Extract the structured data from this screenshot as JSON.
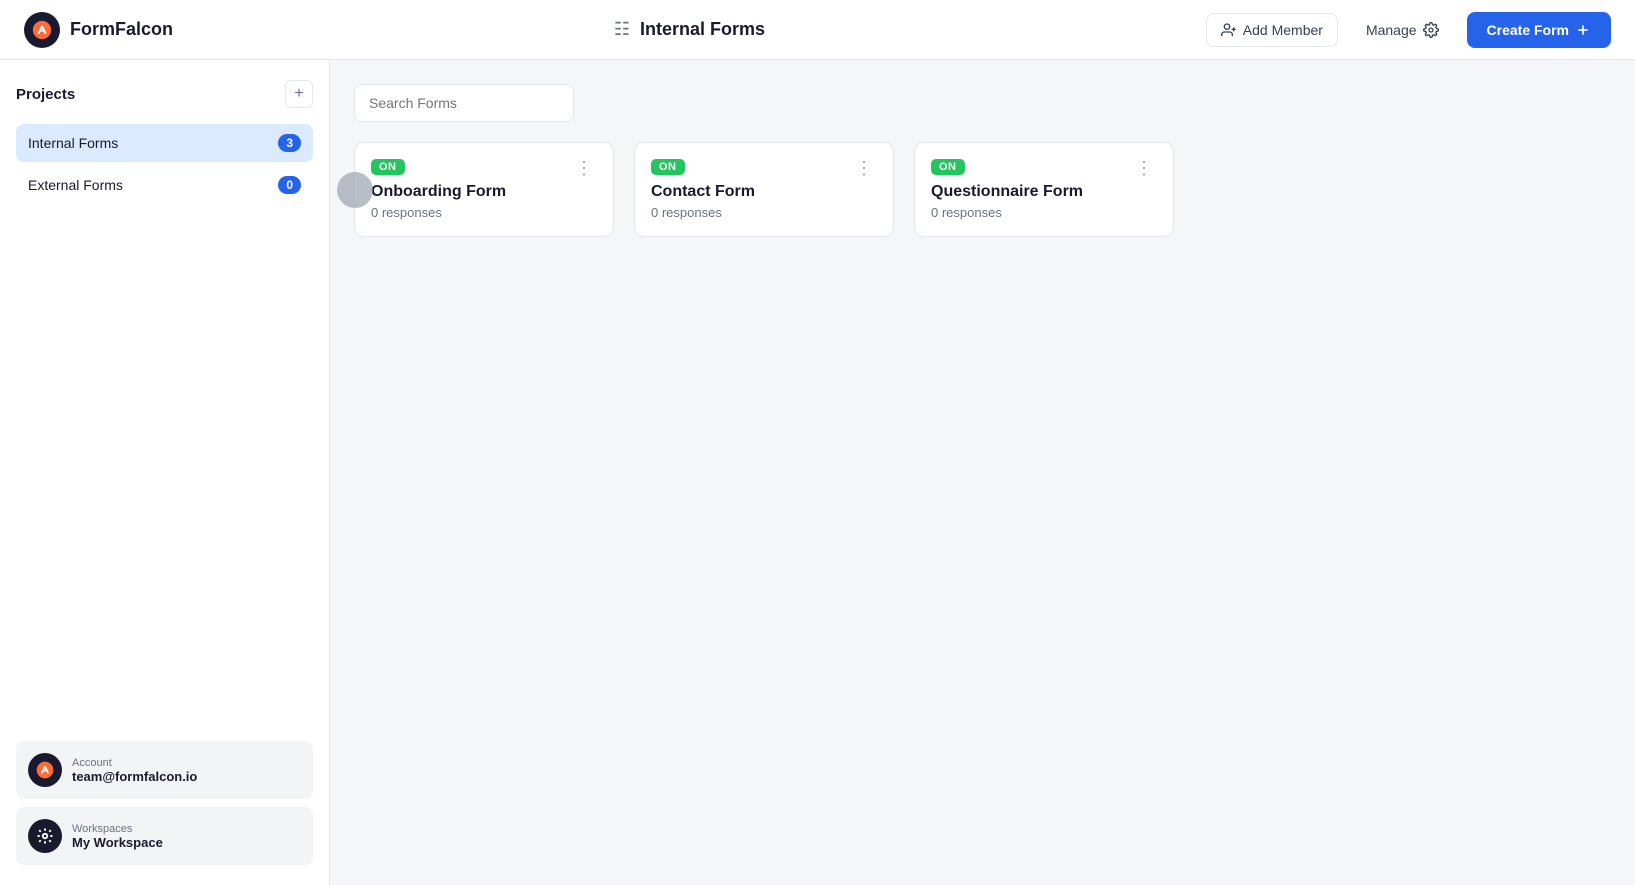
{
  "app": {
    "name": "FormFalcon"
  },
  "header": {
    "page_title": "Internal Forms",
    "add_member_label": "Add Member",
    "manage_label": "Manage",
    "create_form_label": "Create Form"
  },
  "sidebar": {
    "section_title": "Projects",
    "items": [
      {
        "label": "Internal Forms",
        "badge": "3",
        "badge_type": "blue",
        "active": true
      },
      {
        "label": "External Forms",
        "badge": "0",
        "badge_type": "blue",
        "active": false
      }
    ],
    "account": {
      "label": "Account",
      "value": "team@formfalcon.io"
    },
    "workspace": {
      "label": "Workspaces",
      "value": "My Workspace"
    }
  },
  "search": {
    "placeholder": "Search Forms"
  },
  "forms": [
    {
      "status": "ON",
      "name": "Onboarding Form",
      "responses": "0 responses"
    },
    {
      "status": "ON",
      "name": "Contact Form",
      "responses": "0 responses"
    },
    {
      "status": "ON",
      "name": "Questionnaire Form",
      "responses": "0 responses"
    }
  ]
}
